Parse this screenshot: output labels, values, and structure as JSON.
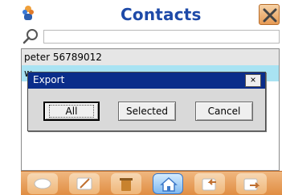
{
  "header": {
    "title": "Contacts",
    "app_icon": "contacts-app-icon",
    "close_icon": "close-icon"
  },
  "search": {
    "icon": "search-icon",
    "value": "",
    "placeholder": ""
  },
  "list": {
    "rows": [
      "peter 56789012",
      "w"
    ]
  },
  "dialog": {
    "title": "Export",
    "close_label": "×",
    "buttons": {
      "all": "All",
      "selected": "Selected",
      "cancel": "Cancel"
    }
  },
  "toolbar": {
    "icons": [
      "eraser-icon",
      "edit-icon",
      "trash-icon",
      "home-icon",
      "import-icon",
      "export-icon"
    ],
    "active": "home-icon"
  },
  "colors": {
    "title": "#1e4aa8",
    "toolbar": "#e08d42",
    "dialog_titlebar": "#0a2d8a",
    "selection": "#a9e3f3"
  }
}
